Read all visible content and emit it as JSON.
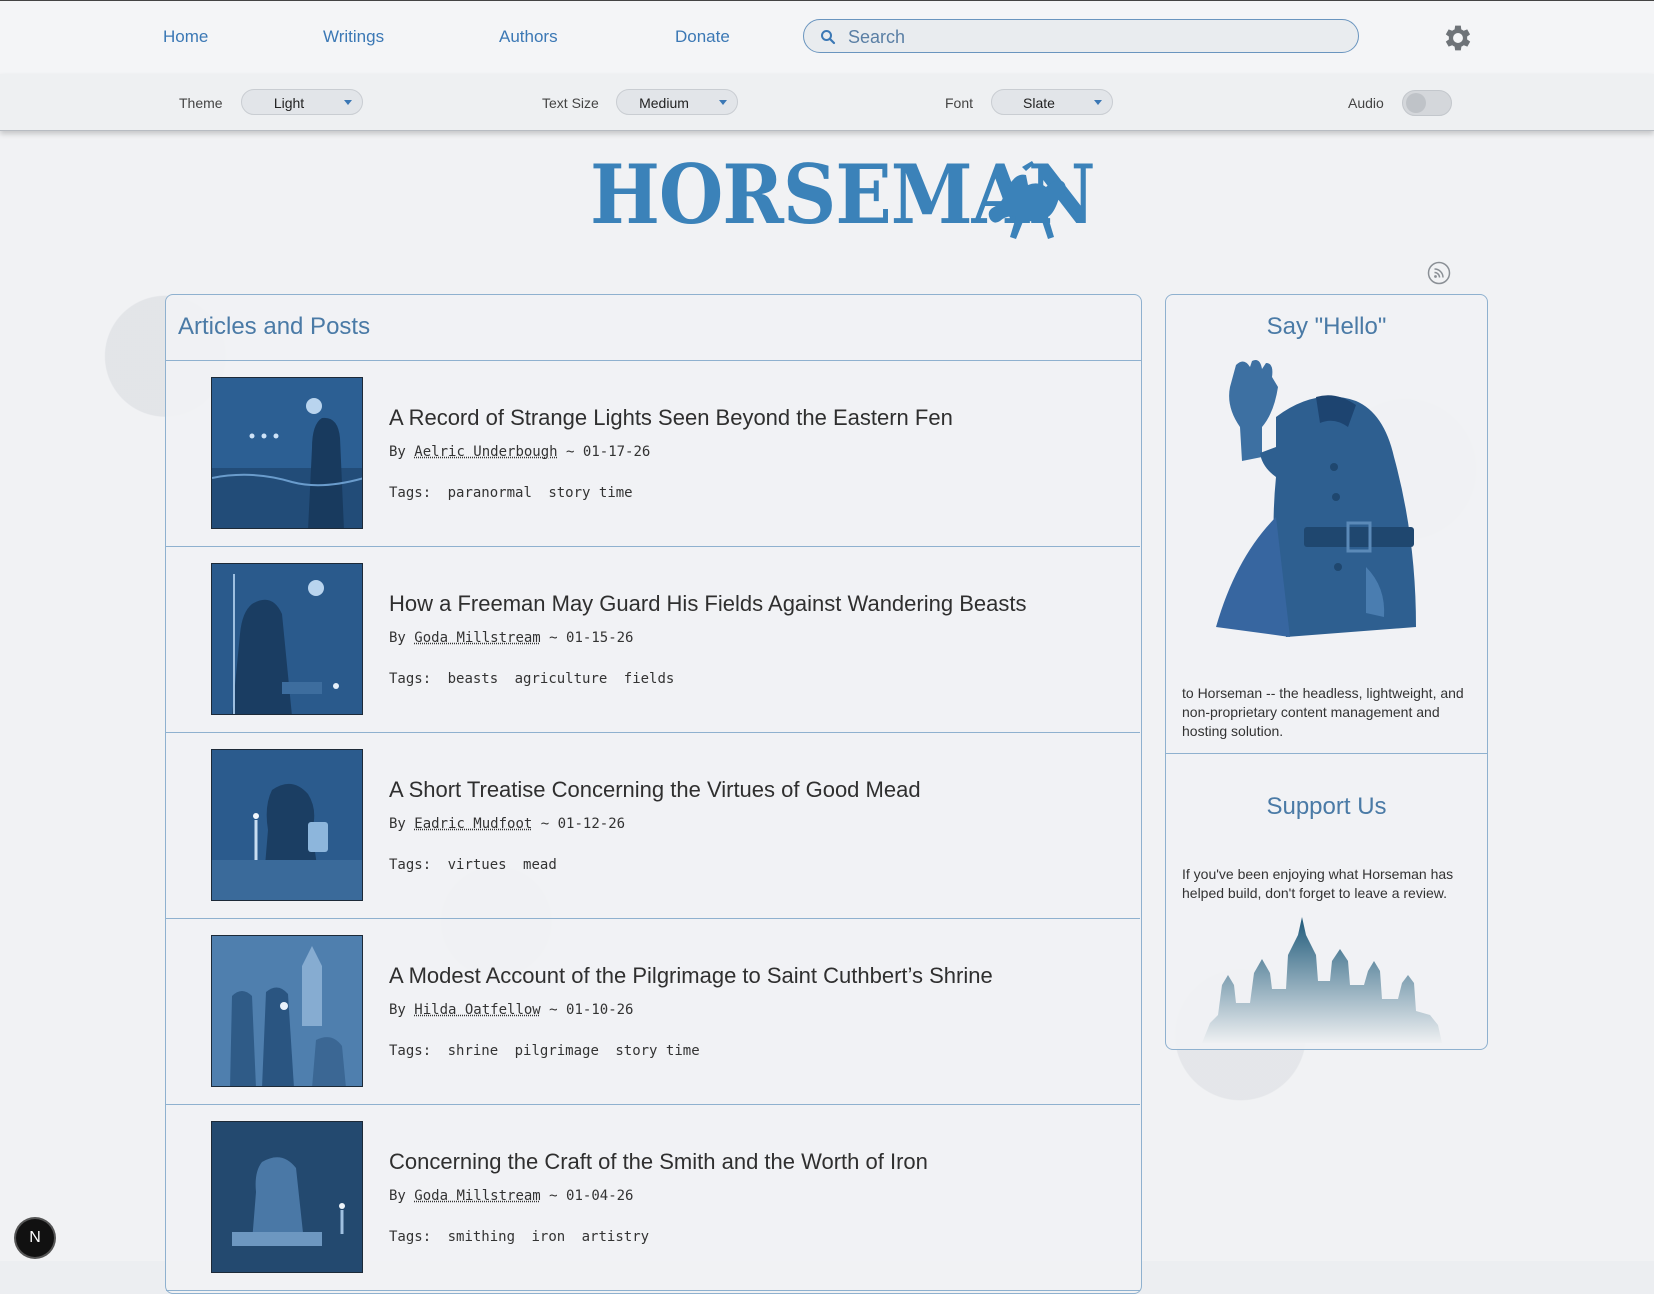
{
  "nav": {
    "items": [
      "Home",
      "Writings",
      "Authors",
      "Donate"
    ],
    "search_placeholder": "Search"
  },
  "settings": {
    "theme_label": "Theme",
    "theme_value": "Light",
    "text_size_label": "Text Size",
    "text_size_value": "Medium",
    "font_label": "Font",
    "font_value": "Slate",
    "audio_label": "Audio",
    "audio_on": false
  },
  "brand": {
    "logo_text": "HORSEMAN"
  },
  "articles": {
    "heading": "Articles and Posts",
    "by_label": "By",
    "tags_label": "Tags:",
    "separator": "~",
    "items": [
      {
        "title": "A Record of Strange Lights Seen Beyond the Eastern Fen",
        "author": "Aelric Underbough",
        "date": "01-17-26",
        "tags": [
          "paranormal",
          "story time"
        ]
      },
      {
        "title": "How a Freeman May Guard His Fields Against Wandering Beasts",
        "author": "Goda Millstream",
        "date": "01-15-26",
        "tags": [
          "beasts",
          "agriculture",
          "fields"
        ]
      },
      {
        "title": "A Short Treatise Concerning the Virtues of Good Mead",
        "author": "Eadric Mudfoot",
        "date": "01-12-26",
        "tags": [
          "virtues",
          "mead"
        ]
      },
      {
        "title": "A Modest Account of the Pilgrimage to Saint Cuthbert’s Shrine",
        "author": "Hilda Oatfellow",
        "date": "01-10-26",
        "tags": [
          "shrine",
          "pilgrimage",
          "story time"
        ]
      },
      {
        "title": "Concerning the Craft of the Smith and the Worth of Iron",
        "author": "Goda Millstream",
        "date": "01-04-26",
        "tags": [
          "smithing",
          "iron",
          "artistry"
        ]
      }
    ]
  },
  "sidebar": {
    "hello_title": "Say \"Hello\"",
    "hello_text": "to Horseman -- the headless, lightweight, and non-proprietary content management and hosting solution.",
    "support_title": "Support Us",
    "support_text": "If you've been enjoying what Horseman has helped build, don't forget to leave a review."
  },
  "badge": {
    "letter": "N"
  },
  "colors": {
    "accent": "#3b78b5",
    "border": "#8fb1cf",
    "logo": "#3b82b9"
  }
}
